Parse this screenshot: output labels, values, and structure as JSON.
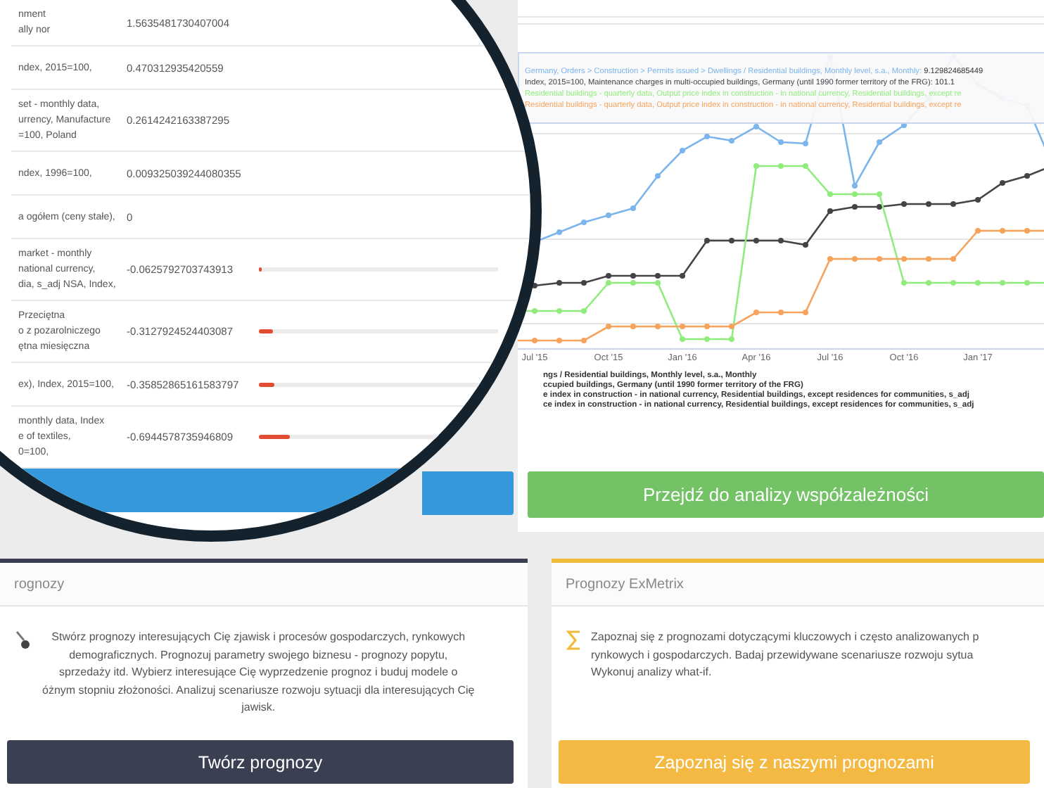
{
  "correlation_table": {
    "rows": [
      {
        "label": "nment\nally nor",
        "value": "1.5635481730407004"
      },
      {
        "label": "ndex, 2015=100,",
        "value": "0.470312935420559"
      },
      {
        "label": "set - monthly data,\nurrency, Manufacture\n=100, Poland",
        "value": "0.2614242163387295"
      },
      {
        "label": "ndex, 1996=100,",
        "value": "0.009325039244080355"
      },
      {
        "label": "a ogółem (ceny stałe),",
        "value": "0"
      },
      {
        "label": "market - monthly\nnational currency,\ndia, s_adj NSA, Index,",
        "value": "-0.0625792703743913",
        "bar": {
          "level": 0.012
        }
      },
      {
        "label": "Przeciętna\no z pozarolniczego\nętna miesięczna",
        "value": "-0.3127924524403087",
        "bar": {
          "level": 0.06
        }
      },
      {
        "label": "ex), Index, 2015=100,",
        "value": "-0.35852865161583797",
        "bar": {
          "level": 0.065
        }
      },
      {
        "label": "monthly data, Index\ne of textiles,\n0=100,",
        "value": "-0.6944578735946809",
        "bar": {
          "level": 0.13
        }
      }
    ]
  },
  "chart": {
    "tooltip": [
      {
        "text": "Germany, Orders > Construction > Permits issued > Dwellings / Residential buildings, Monthly level, s.a., Monthly:",
        "value": "9.129824685449",
        "color": "#7cb5ec"
      },
      {
        "text": "Index, 2015=100, Maintenance charges in multi-occupied buildings, Germany (until 1990 former territory of the FRG):",
        "value": "101.1",
        "color": "#434348"
      },
      {
        "text": "Residential buildings - quarterly data, Output price index in construction - in national currency, Residential buildings, except re",
        "color": "#90ed7d"
      },
      {
        "text": "Residential buildings - quarterly data, Output price index in construction - in national currency, Residential buildings, except re",
        "color": "#f7a35c"
      }
    ],
    "x_labels": [
      "Jul '15",
      "Oct '15",
      "Jan '16",
      "Apr '16",
      "Jul '16",
      "Oct '16",
      "Jan '17"
    ],
    "legend": [
      "ngs / Residential buildings, Monthly level, s.a., Monthly",
      "ccupied buildings, Germany (until 1990 former territory of the FRG)",
      "e index in construction - in national currency, Residential buildings, except residences for communities, s_adj",
      "ce index in construction - in national currency, Residential buildings, except residences for communities, s_adj"
    ]
  },
  "correlation_button": {
    "label": "Przejdź do analizy współzależności"
  },
  "cards": [
    {
      "kind": "create",
      "title": "rognozy",
      "text": "Stwórz prognozy interesujących Cię zjawisk i procesów gospodarczych, rynkowych\ndemograficznych. Prognozuj parametry swojego biznesu - prognozy popytu,\nsprzedaży itd. Wybierz interesujące Cię wyprzedzenie prognoz i buduj modele o\nóżnym stopniu złożoności. Analizuj scenariusze rozwoju sytuacji dla interesujących Cię\njawisk.",
      "button": "Twórz prognozy"
    },
    {
      "kind": "browse",
      "title": "Prognozy ExMetrix",
      "text": "Zapoznaj się z prognozami dotyczącymi kluczowych i często analizowanych p\nrynkowych i gospodarczych. Badaj przewidywane scenariusze rozwoju sytua\nWykonuj analizy what-if.",
      "button": "Zapoznaj się z naszymi prognozami"
    }
  ]
}
